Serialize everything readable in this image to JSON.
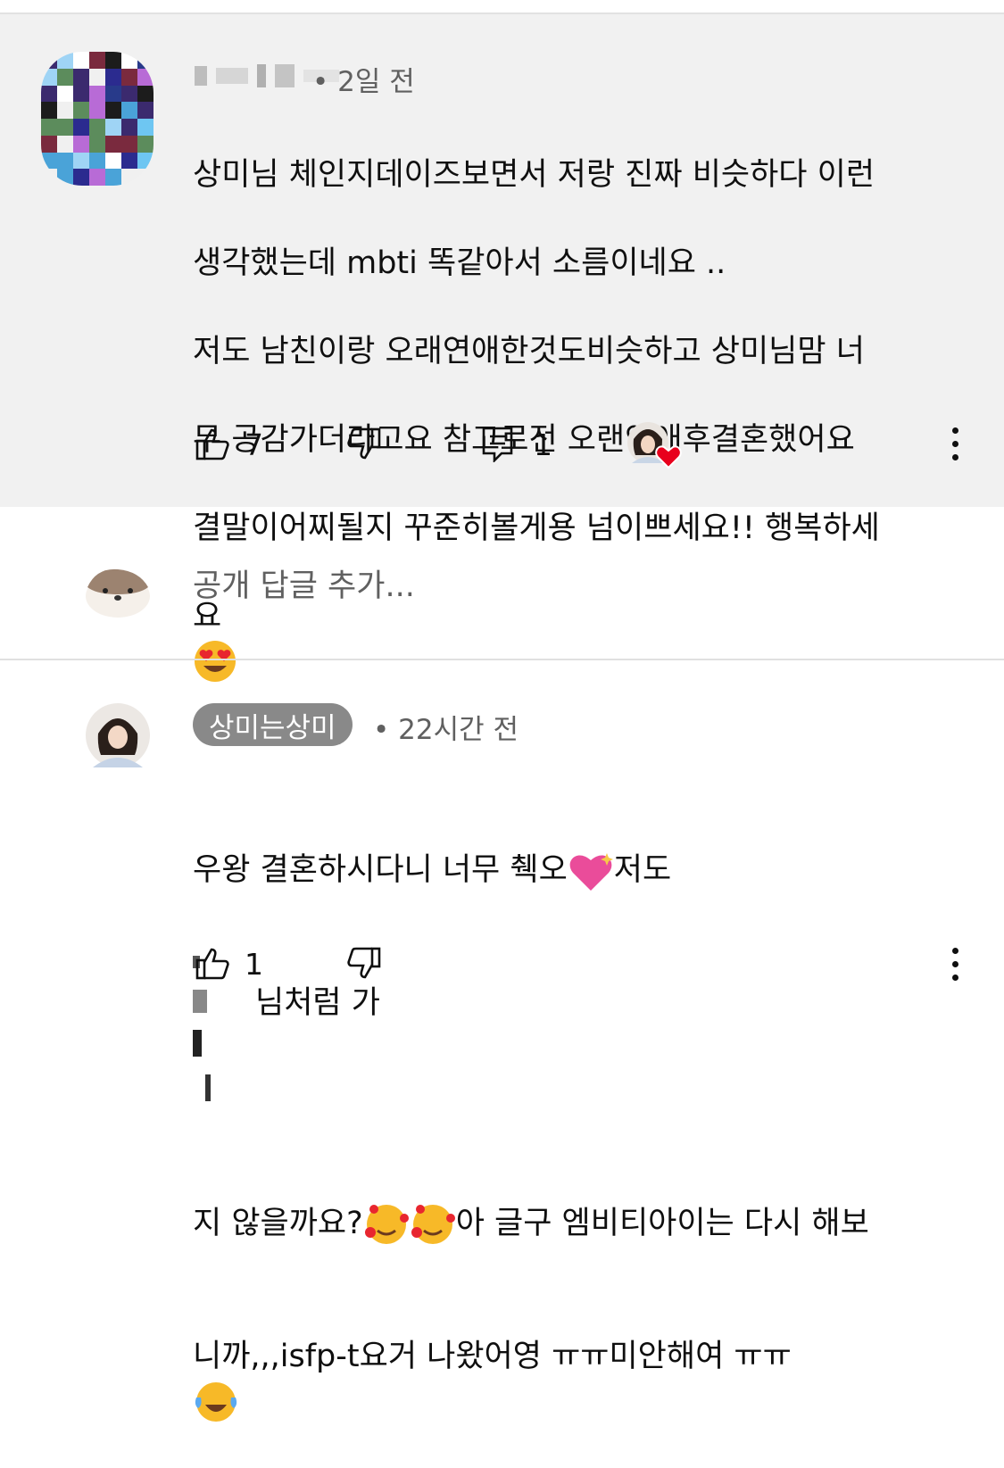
{
  "comment1": {
    "time": "• 2일 전",
    "lines": [
      "상미님 체인지데이즈보면서 저랑 진짜 비슷하다 이런",
      "생각했는데 mbti 똑같아서 소름이네요 ..",
      "저도 남친이랑 오래연애한것도비슷하고 상미님맘 너",
      "무 공감가더라고요 참고로전 오랜연애후결혼했어요",
      "결말이어찌될지 꾸준히볼게용 넘이쁘세요!! 행복하세",
      "요"
    ],
    "like_count": "7",
    "reply_count": "1"
  },
  "reply_box": {
    "placeholder": "공개 답글 추가..."
  },
  "comment2": {
    "author": "상미는상미",
    "time": "• 22시간 전",
    "line1_a": "우왕 결혼하시다니 너무 췍오",
    "line1_b": "저도",
    "line1_c": "님처럼 가",
    "line2_a": "지 않을까요?",
    "line2_b": "아 글구 엠비티아이는 다시 해보",
    "line3_a": "니까,,,isfp-t요거 나왔어영 ㅠㅠ미안해여 ㅠㅠ",
    "like_count": "1"
  },
  "icons": {
    "like": "thumbs-up-icon",
    "dislike": "thumbs-down-icon",
    "reply": "comment-icon",
    "more": "more-vert-icon",
    "heart": "creator-heart-icon"
  },
  "colors": {
    "comment_bg": "#f1f1f1",
    "chip_bg": "#898989",
    "heart": "#e8001c"
  }
}
